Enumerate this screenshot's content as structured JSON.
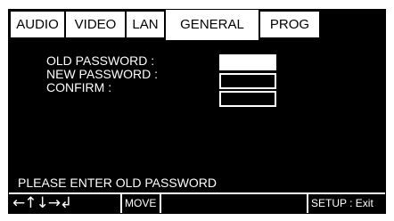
{
  "tabs": [
    {
      "label": "AUDIO",
      "active": false
    },
    {
      "label": "VIDEO",
      "active": false
    },
    {
      "label": "LAN",
      "active": false
    },
    {
      "label": "GENERAL",
      "active": true
    },
    {
      "label": "PROG",
      "active": false
    }
  ],
  "form": {
    "old_password_label": "OLD PASSWORD :",
    "new_password_label": "NEW PASSWORD :",
    "confirm_label": "CONFIRM :",
    "old_password_value": "",
    "new_password_value": "",
    "confirm_value": ""
  },
  "status": {
    "message": "PLEASE ENTER OLD PASSWORD"
  },
  "footer": {
    "arrow_glyphs": "←↑↓→↲",
    "move_label": "MOVE",
    "setup_label": "SETUP : Exit"
  }
}
